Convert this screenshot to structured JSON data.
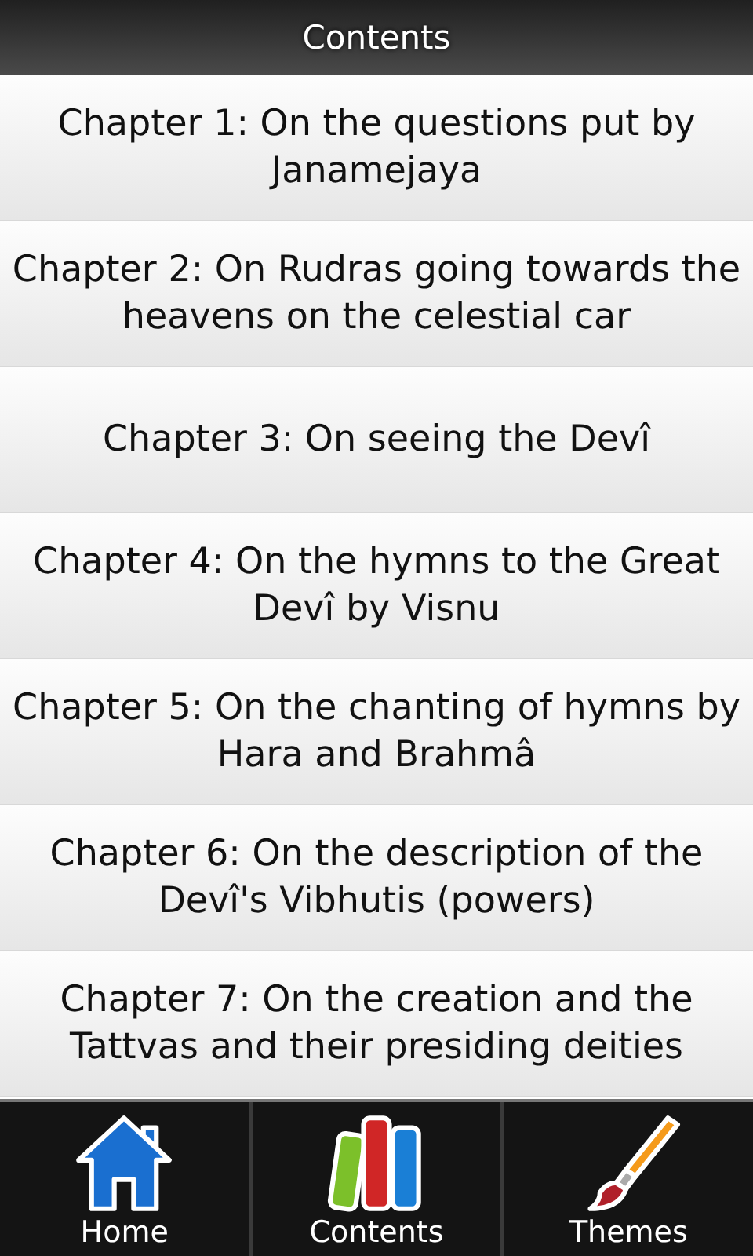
{
  "title": "Contents",
  "chapters": [
    {
      "title": "Chapter 1: On the questions put by Janamejaya"
    },
    {
      "title": "Chapter 2: On Rudras going towards the heavens on the celestial car"
    },
    {
      "title": "Chapter 3: On seeing the Devî"
    },
    {
      "title": "Chapter 4: On the hymns to the Great Devî by Visnu"
    },
    {
      "title": "Chapter 5: On the chanting of hymns by Hara and Brahmâ"
    },
    {
      "title": "Chapter 6: On the description of the Devî's Vibhutis (powers)"
    },
    {
      "title": "Chapter 7: On the creation and the Tattvas and their presiding deities"
    }
  ],
  "tabs": [
    {
      "label": "Home",
      "kind": "house"
    },
    {
      "label": "Contents",
      "kind": "books"
    },
    {
      "label": "Themes",
      "kind": "brush"
    }
  ]
}
